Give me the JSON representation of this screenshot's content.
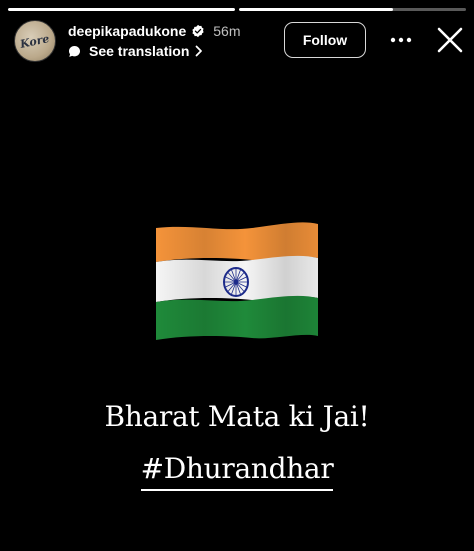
{
  "story": {
    "segments": [
      {
        "progress": 1.0
      },
      {
        "progress": 0.68
      }
    ]
  },
  "header": {
    "username": "deepikapadukone",
    "verified": true,
    "timestamp": "56m",
    "translate_label": "See translation",
    "follow_label": "Follow",
    "avatar_text": "Kore"
  },
  "content": {
    "caption": "Bharat Mata ki Jai!",
    "hashtag": "#Dhurandhar"
  },
  "colors": {
    "background": "#000000",
    "saffron": "#f4933a",
    "white": "#f5f5f5",
    "green": "#1f8a3a",
    "chakra": "#1d2b8a"
  },
  "icons": {
    "verified": "verified-badge-icon",
    "translate": "translate-bubble-icon",
    "chevron": "chevron-right-icon",
    "more": "more-options-icon",
    "close": "close-icon"
  }
}
